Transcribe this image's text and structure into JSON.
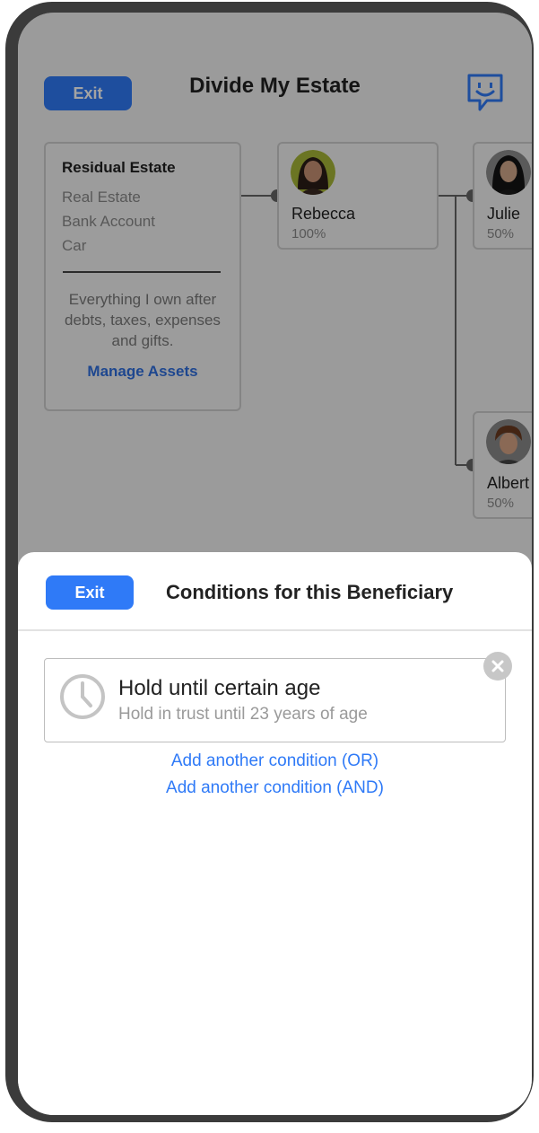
{
  "header": {
    "exit_label": "Exit",
    "title": "Divide My Estate"
  },
  "residual": {
    "title": "Residual Estate",
    "items": [
      "Real Estate",
      "Bank Account",
      "Car"
    ],
    "description": "Everything I own after debts, taxes, expenses and gifts.",
    "manage_label": "Manage Assets"
  },
  "beneficiaries": [
    {
      "name": "Rebecca",
      "percent": "100%"
    },
    {
      "name": "Julie",
      "percent": "50%"
    },
    {
      "name": "Albert",
      "percent": "50%"
    }
  ],
  "sheet": {
    "exit_label": "Exit",
    "title": "Conditions for this Beneficiary",
    "condition": {
      "title": "Hold until certain age",
      "subtitle": "Hold in trust until 23 years of age"
    },
    "add_or_label": "Add another condition (OR)",
    "add_and_label": "Add another condition (AND)"
  },
  "colors": {
    "accent": "#2f7af7",
    "manage_link": "#2f6fe0"
  },
  "icons": [
    "chat-support-icon",
    "clock-icon",
    "close-icon",
    "avatar-rebecca",
    "avatar-julie",
    "avatar-albert"
  ]
}
